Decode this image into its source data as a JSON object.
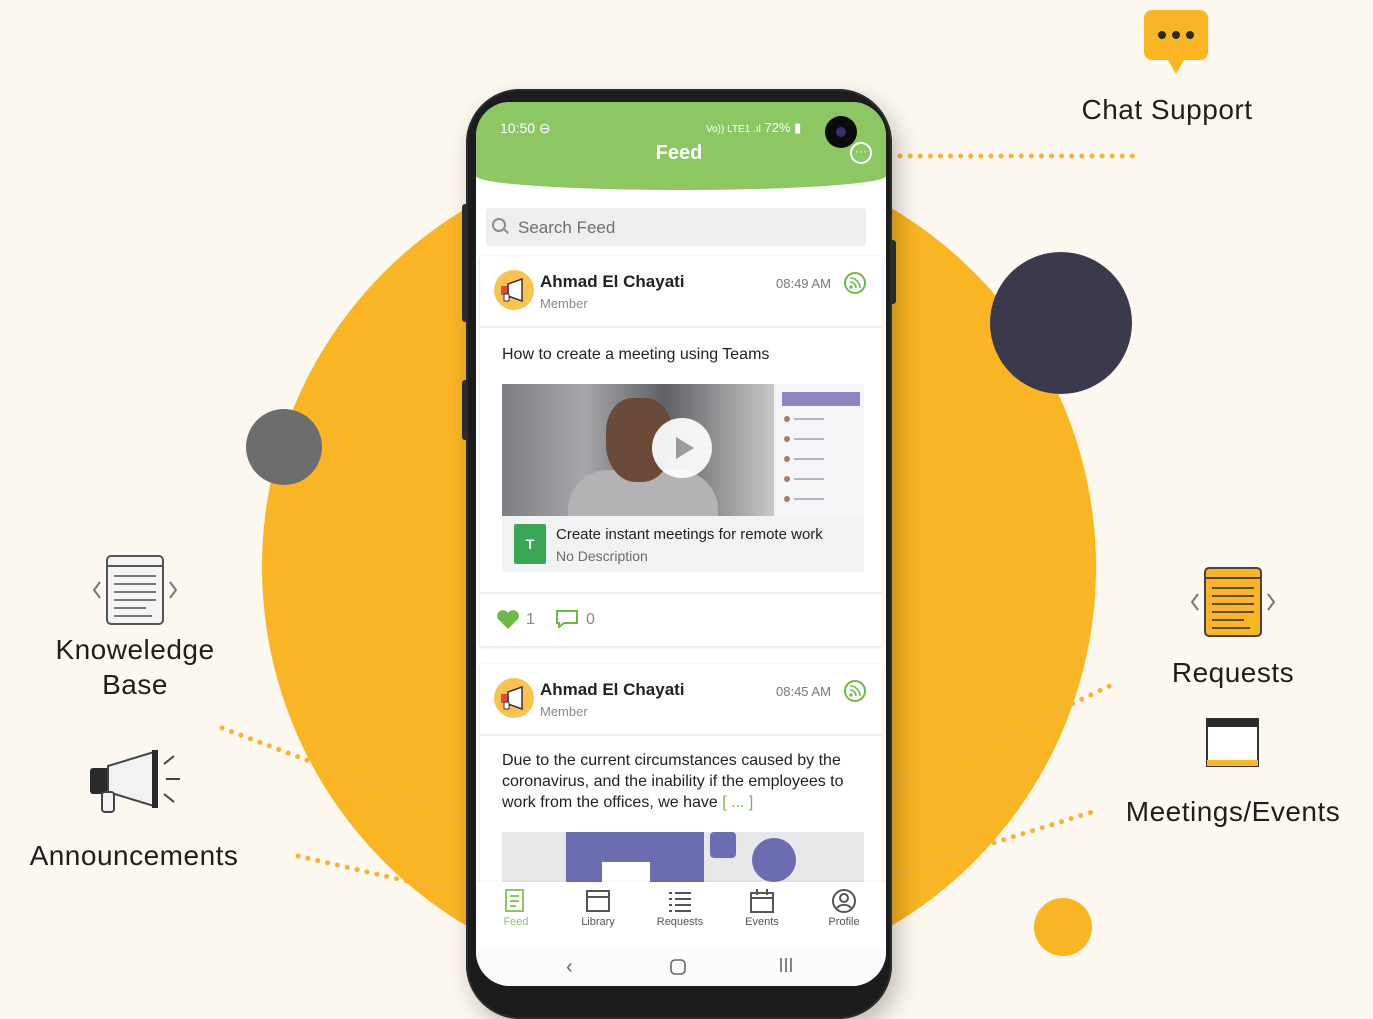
{
  "side_features": {
    "chat_support": "Chat Support",
    "knowledge_base": "Knoweledge\nBase",
    "announcements": "Announcements",
    "requests": "Requests",
    "meetings_events": "Meetings/Events"
  },
  "status_bar": {
    "time": "10:50 ⊖",
    "signal": "Vo)) LTE1 .ıl",
    "battery": "72%"
  },
  "header": {
    "title": "Feed"
  },
  "search": {
    "placeholder": "Search Feed"
  },
  "posts": [
    {
      "author": "Ahmad El Chayati",
      "role": "Member",
      "time": "08:49 AM",
      "text": "How to create a meeting using Teams",
      "attachment": {
        "title": "Create instant meetings for remote work",
        "description": "No Description",
        "icon_text": "T"
      },
      "likes": "1",
      "comments": "0"
    },
    {
      "author": "Ahmad El Chayati",
      "role": "Member",
      "time": "08:45 AM",
      "text": "Due to the current circumstances caused by the coronavirus, and the inability if the employees to work from the offices, we have",
      "more": "[ ... ]"
    }
  ],
  "bottom_nav": [
    {
      "label": "Feed",
      "icon": "feed-icon",
      "active": true
    },
    {
      "label": "Library",
      "icon": "library-icon"
    },
    {
      "label": "Requests",
      "icon": "requests-icon"
    },
    {
      "label": "Events",
      "icon": "events-icon"
    },
    {
      "label": "Profile",
      "icon": "profile-icon"
    }
  ],
  "colors": {
    "accent_green": "#8cc764",
    "circle_yellow": "#f9b523",
    "circle_dark": "#3b3a4c",
    "background": "#fdf8ef"
  }
}
